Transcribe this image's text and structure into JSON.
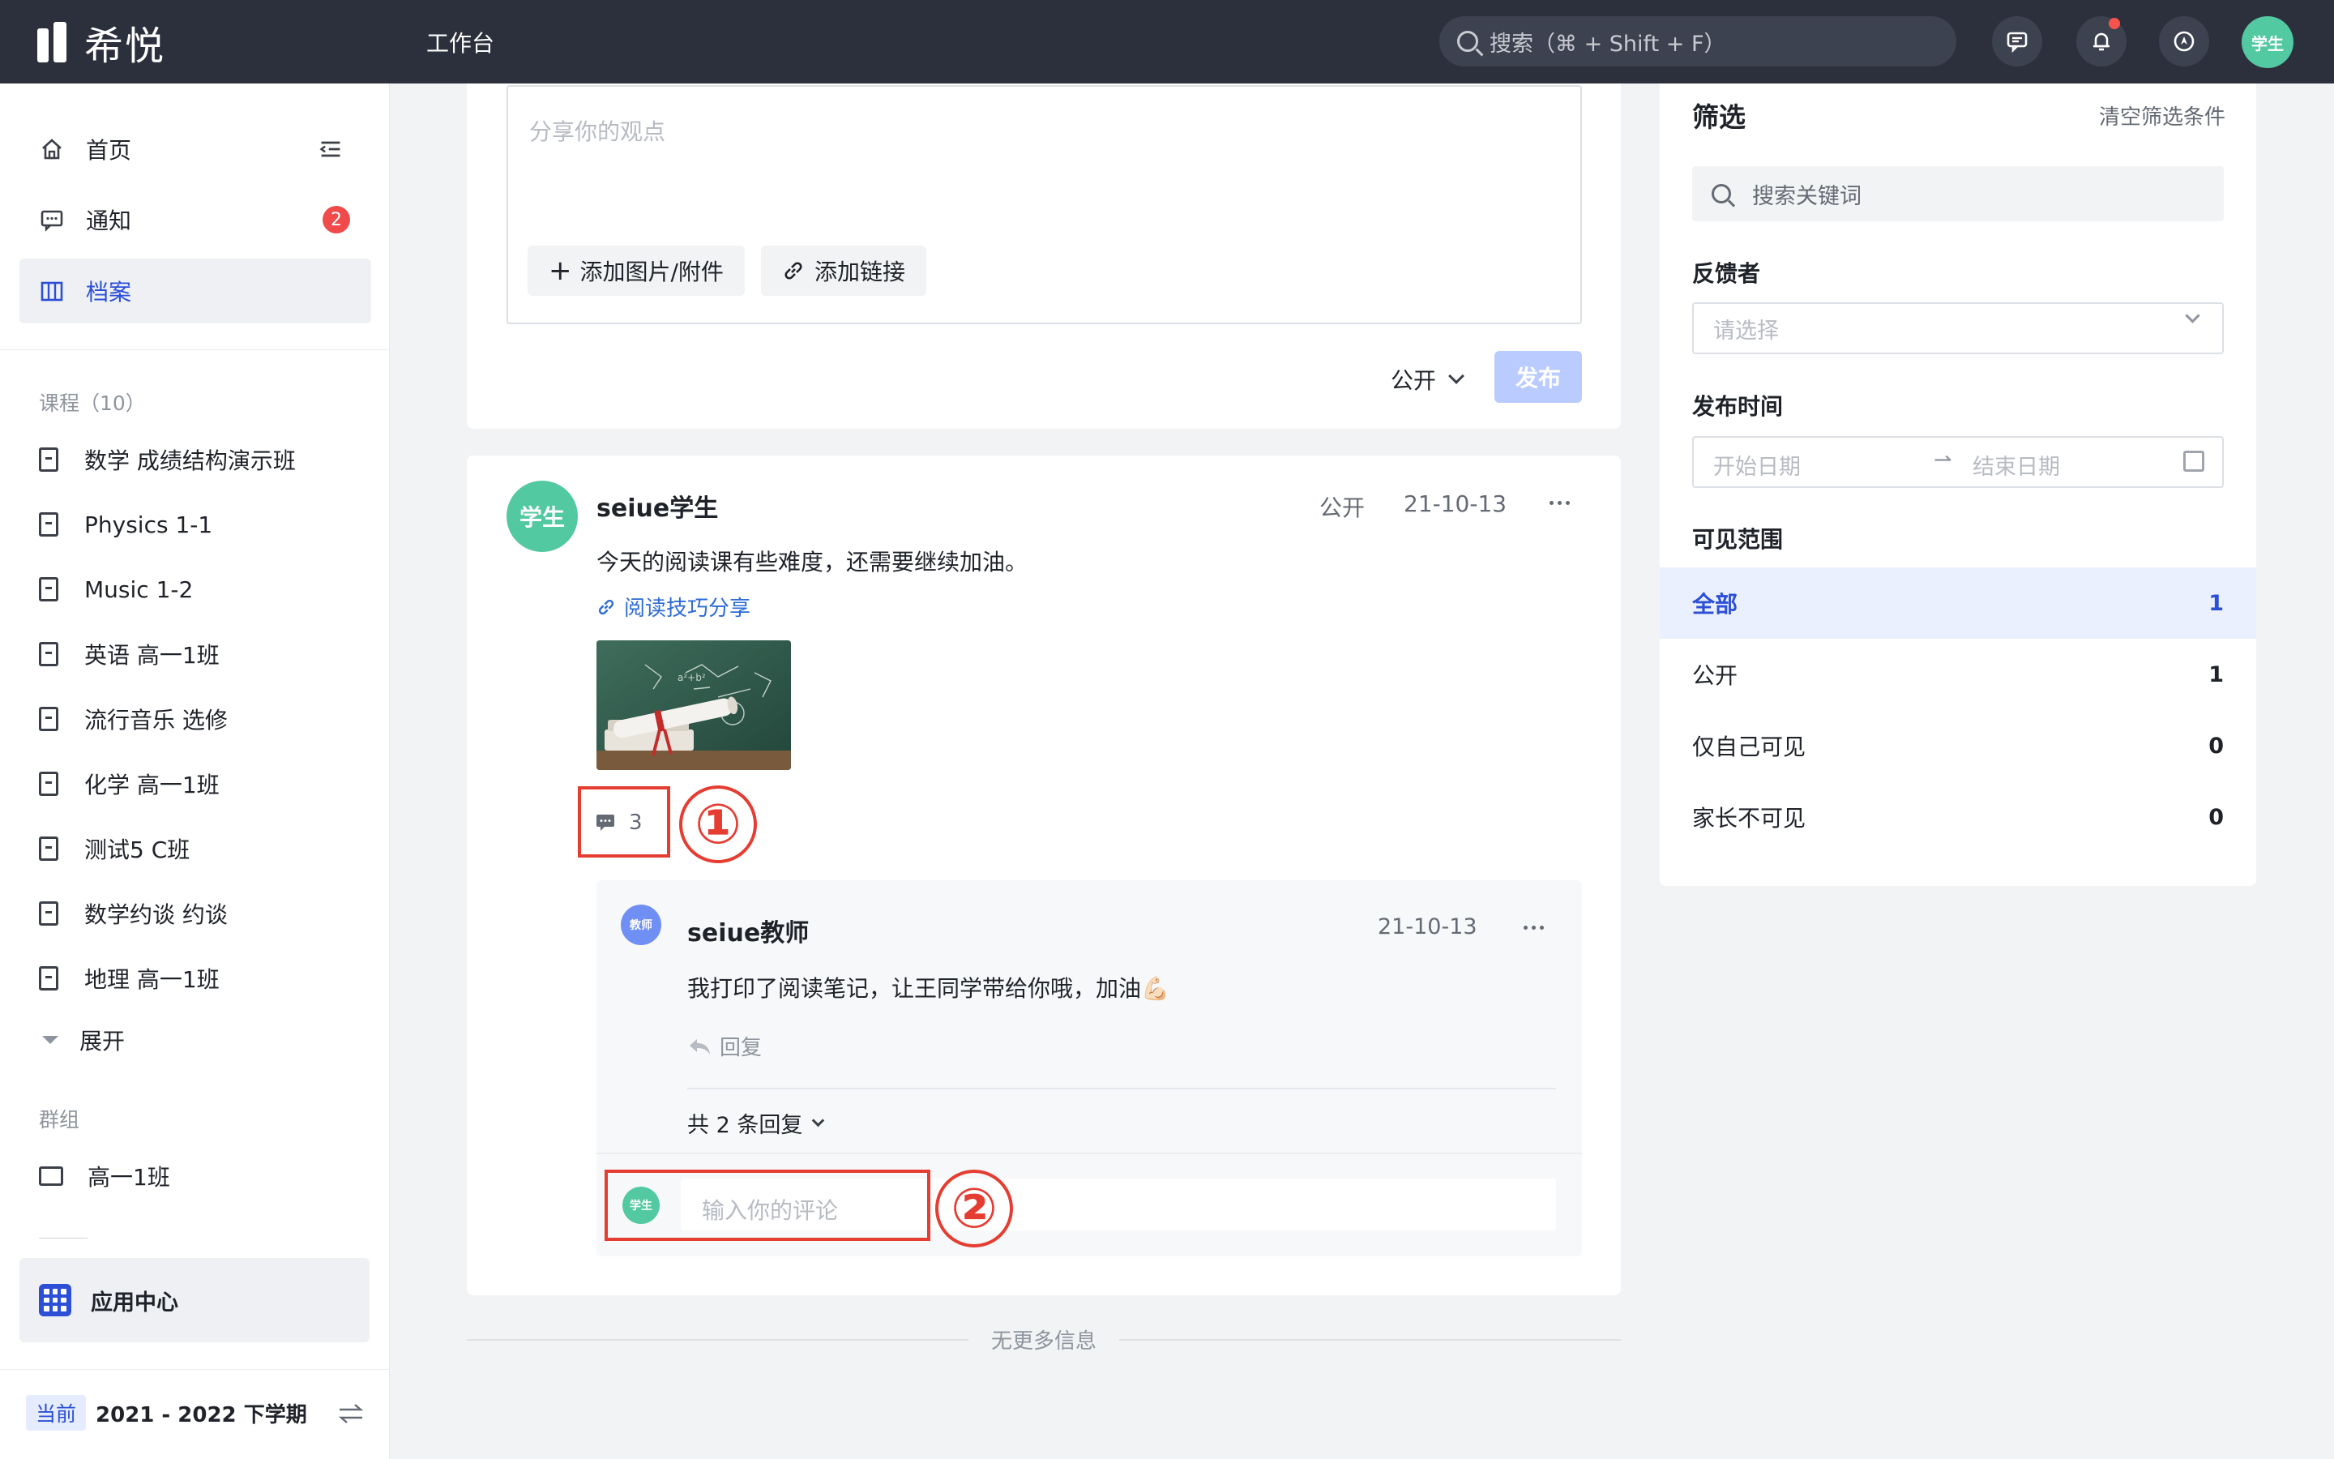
{
  "topbar": {
    "logo_text": "希悦",
    "workbench": "工作台",
    "search_placeholder": "搜索（⌘ + Shift + F）",
    "avatar_text": "学生"
  },
  "sidebar": {
    "nav": [
      {
        "label": "首页"
      },
      {
        "label": "通知",
        "badge": "2"
      },
      {
        "label": "档案"
      }
    ],
    "courses_title": "课程（10）",
    "courses": [
      "数学 成绩结构演示班",
      "Physics 1-1",
      "Music 1-2",
      "英语 高一1班",
      "流行音乐 选修",
      "化学 高一1班",
      "测试5 C班",
      "数学约谈 约谈",
      "地理 高一1班"
    ],
    "expand": "展开",
    "groups_title": "群组",
    "groups": [
      "高一1班"
    ],
    "app_center": "应用中心",
    "term_tag": "当前",
    "term": "2021 - 2022 下学期"
  },
  "composer": {
    "placeholder": "分享你的观点",
    "add_image": "添加图片/附件",
    "add_link": "添加链接",
    "visibility": "公开",
    "publish": "发布"
  },
  "post": {
    "avatar": "学生",
    "author": "seiue学生",
    "visibility": "公开",
    "date": "21-10-13",
    "text": "今天的阅读课有些难度，还需要继续加油。",
    "link": "阅读技巧分享",
    "comment_count": "3",
    "annotation_1": "①",
    "annotation_2": "②",
    "comment": {
      "avatar": "教师",
      "author": "seiue教师",
      "date": "21-10-13",
      "text": "我打印了阅读笔记，让王同学带给你哦，加油💪🏻",
      "reply": "回复",
      "reply_count": "共 2 条回复"
    },
    "input_avatar": "学生",
    "input_placeholder": "输入你的评论"
  },
  "no_more": "无更多信息",
  "filter": {
    "title": "筛选",
    "clear": "清空筛选条件",
    "search_placeholder": "搜索关键词",
    "feedback_label": "反馈者",
    "feedback_placeholder": "请选择",
    "time_label": "发布时间",
    "start_date": "开始日期",
    "end_date": "结束日期",
    "range_arrow": "⇀",
    "scope_label": "可见范围",
    "scopes": [
      {
        "label": "全部",
        "count": "1"
      },
      {
        "label": "公开",
        "count": "1"
      },
      {
        "label": "仅自己可见",
        "count": "0"
      },
      {
        "label": "家长不可见",
        "count": "0"
      }
    ]
  },
  "colors": {
    "topbar": "#2c303c",
    "accent": "#2c4fd6",
    "student_avatar": "#52c9a0",
    "annotation": "#e53d31"
  }
}
